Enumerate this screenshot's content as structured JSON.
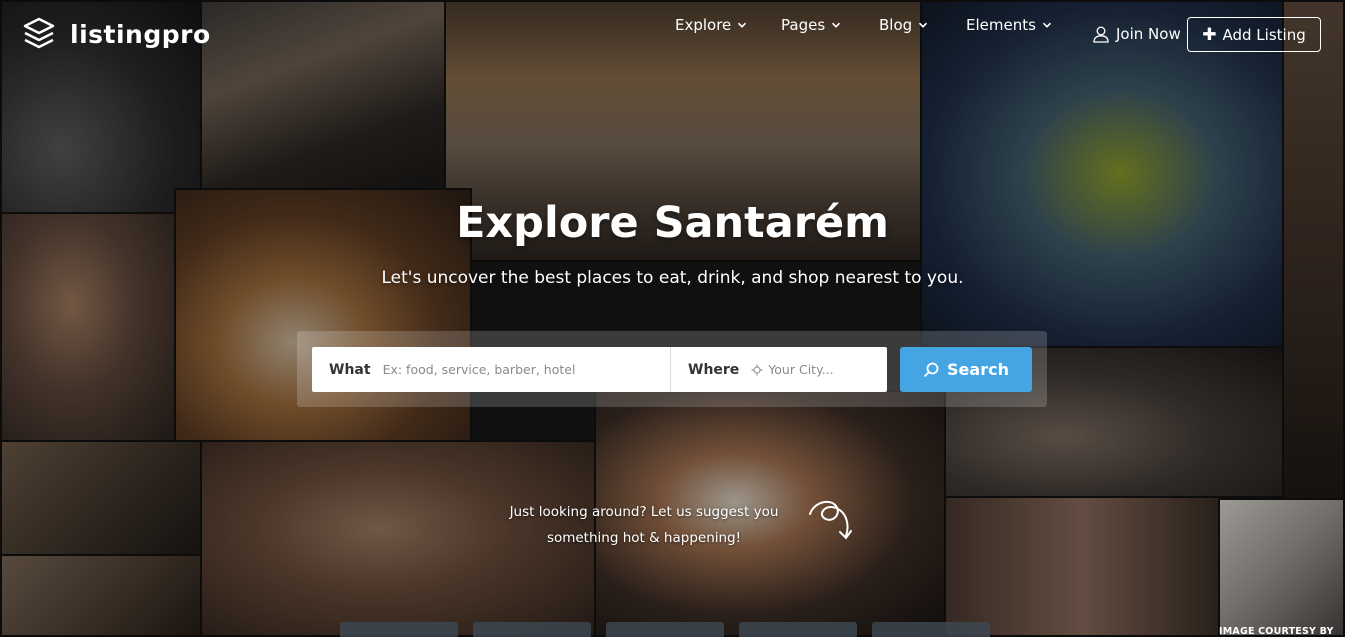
{
  "brand": {
    "name": "listingpro"
  },
  "nav": {
    "items": [
      {
        "label": "Explore",
        "icon": "chevron-down-icon"
      },
      {
        "label": "Pages",
        "icon": "chevron-down-icon"
      },
      {
        "label": "Blog",
        "icon": "chevron-down-icon"
      },
      {
        "label": "Elements",
        "icon": "chevron-down-icon"
      }
    ],
    "join_label": "Join Now",
    "join_icon": "user-icon",
    "add_listing_label": "Add Listing",
    "add_listing_icon": "plus-icon"
  },
  "hero": {
    "title": "Explore Santarém",
    "subtitle": "Let's uncover the best places to eat, drink, and shop nearest to you."
  },
  "search": {
    "what_label": "What",
    "what_placeholder": "Ex: food, service, barber, hotel",
    "where_label": "Where",
    "where_placeholder": "Your City...",
    "where_icon": "crosshair-icon",
    "button_label": "Search",
    "button_icon": "search-icon",
    "button_color": "#45a5e3"
  },
  "suggest": {
    "line1": "Just looking around? Let us suggest you",
    "line2": "something hot & happening!"
  },
  "footer_note": "IMAGE COURTESY BY"
}
